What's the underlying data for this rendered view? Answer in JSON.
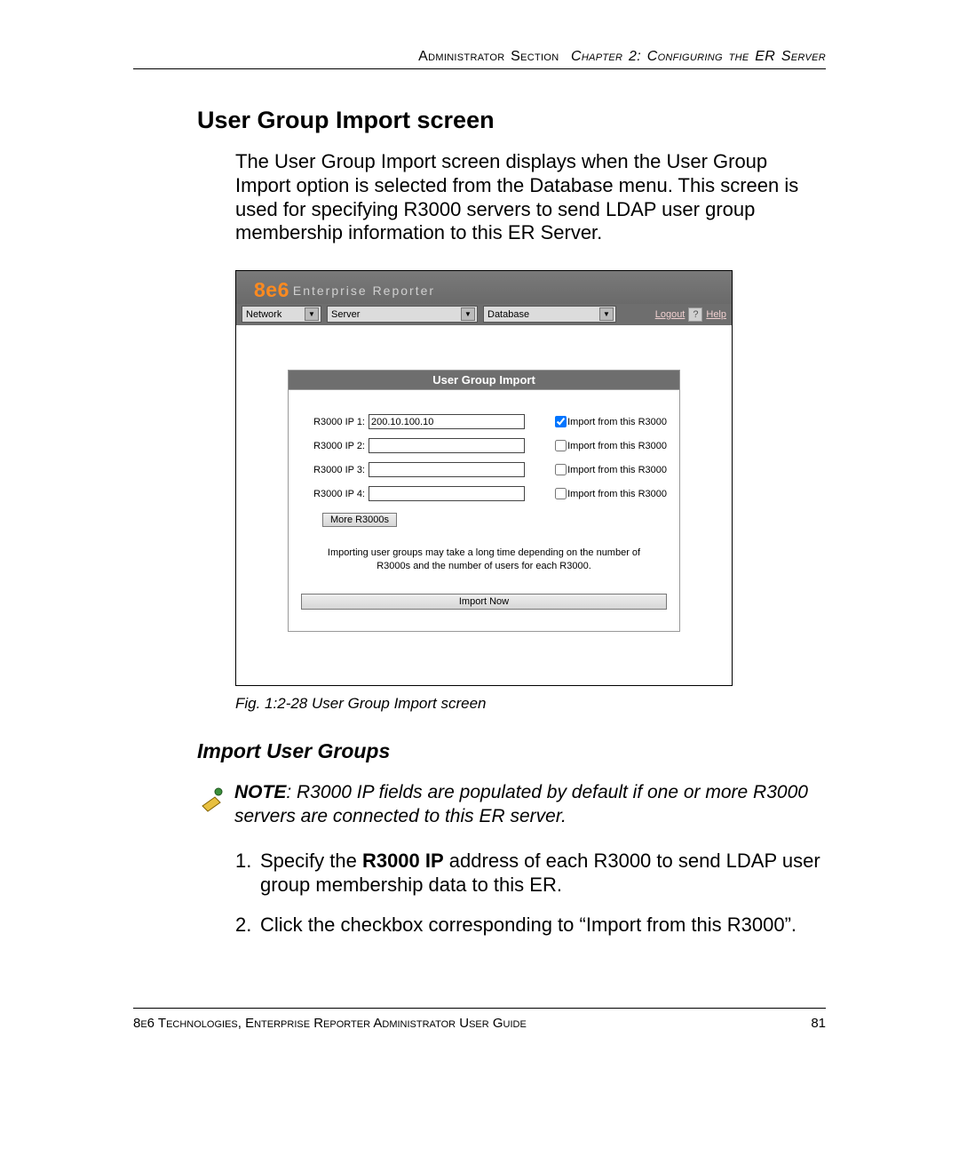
{
  "page": {
    "header_section": "Administrator Section",
    "header_chapter": "Chapter 2: Configuring the ER Server",
    "h_main": "User Group Import screen",
    "intro": "The User Group Import screen displays when the User Group Import option is selected from the Database menu. This screen is used for specifying R3000 servers to send LDAP user group membership information to this ER Server.",
    "caption": "Fig. 1:2-28  User Group Import screen",
    "h_sub": "Import User Groups",
    "note_label": "NOTE",
    "note_text": ": R3000 IP fields are populated by default if one or more R3000 servers are connected to this ER server.",
    "step1_pre": "Specify the ",
    "step1_bold": "R3000 IP",
    "step1_post": " address of each R3000 to send LDAP user group membership data to this ER.",
    "step2": "Click the checkbox corresponding to “Import from this R3000”.",
    "footer_text": "8e6 Technologies, Enterprise Reporter Administrator User Guide",
    "page_num": "81"
  },
  "app": {
    "brand_num": "8e6",
    "brand_text": "Enterprise Reporter",
    "menus": {
      "network": "Network",
      "server": "Server",
      "database": "Database"
    },
    "logout": "Logout",
    "q": "?",
    "help": "Help",
    "panel_title": "User Group Import",
    "rows": [
      {
        "label": "R3000 IP 1:",
        "value": "200.10.100.10",
        "cb_label": "Import from this R3000"
      },
      {
        "label": "R3000 IP 2:",
        "value": "",
        "cb_label": "Import from this R3000"
      },
      {
        "label": "R3000 IP 3:",
        "value": "",
        "cb_label": "Import from this R3000"
      },
      {
        "label": "R3000 IP 4:",
        "value": "",
        "cb_label": "Import from this R3000"
      }
    ],
    "more_btn": "More R3000s",
    "note": "Importing user groups may take a long time depending on the number of R3000s and the number of users for each R3000.",
    "import_btn": "Import Now"
  }
}
